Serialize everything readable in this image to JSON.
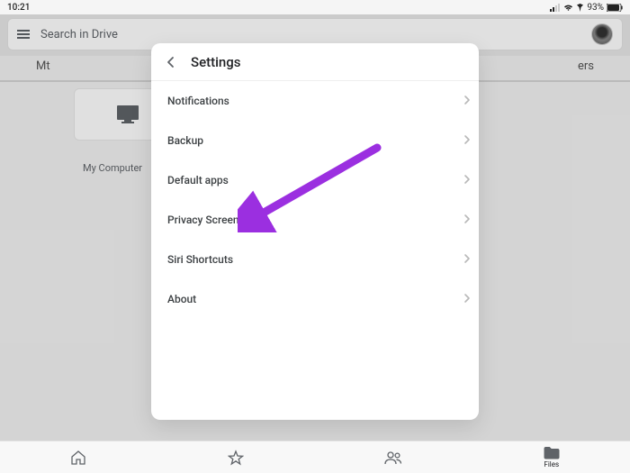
{
  "status": {
    "time": "10:21",
    "battery_pct": "93%"
  },
  "search": {
    "placeholder": "Search in Drive"
  },
  "background": {
    "left_trunc": "Mt",
    "right_trunc": "ers",
    "card_label": "My Computer"
  },
  "modal": {
    "title": "Settings",
    "items": [
      {
        "label": "Notifications"
      },
      {
        "label": "Backup"
      },
      {
        "label": "Default apps"
      },
      {
        "label": "Privacy Screen"
      },
      {
        "label": "Siri Shortcuts"
      },
      {
        "label": "About"
      }
    ]
  },
  "tabs": {
    "files_label": "Files"
  },
  "annotation": {
    "color": "#9b2fe0"
  }
}
